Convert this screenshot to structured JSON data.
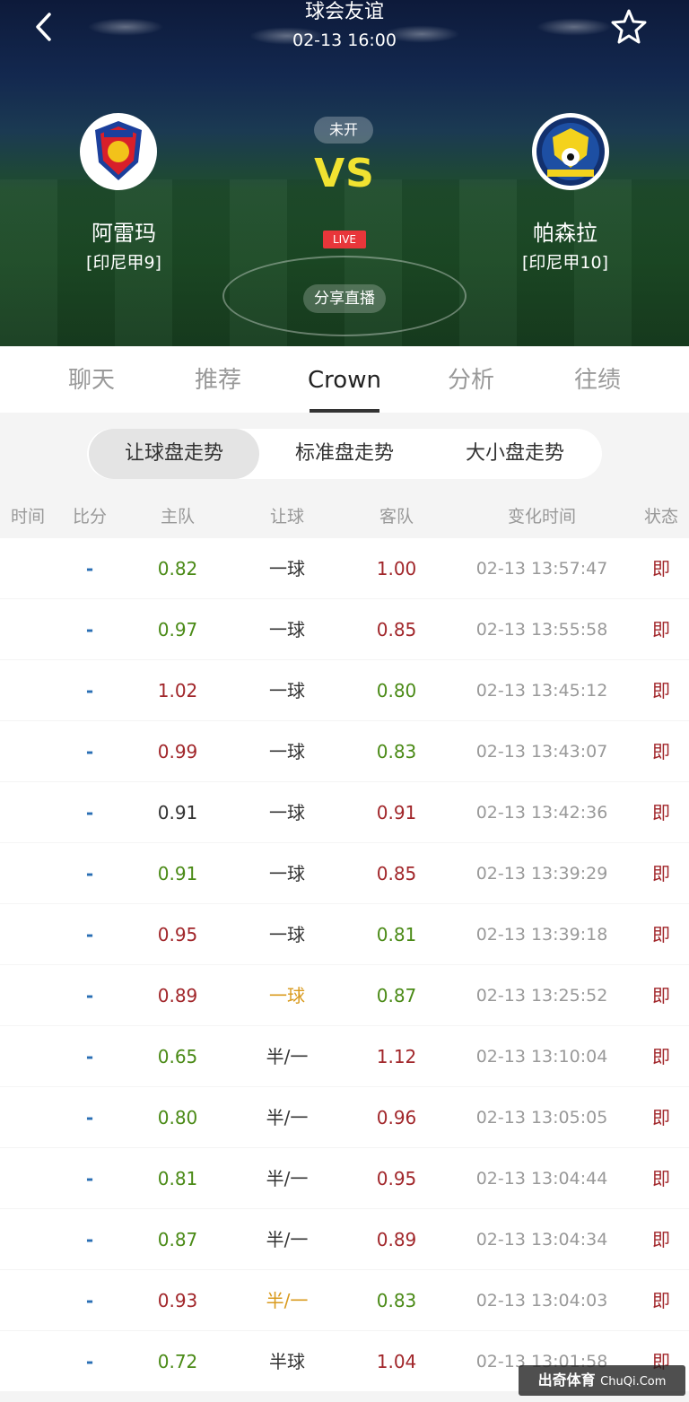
{
  "header": {
    "title": "球会友谊",
    "datetime": "02-13 16:00",
    "status": "未开",
    "vs": "VS",
    "live": "LIVE",
    "share": "分享直播",
    "home": {
      "name": "阿雷玛",
      "rank": "[印尼甲9]"
    },
    "away": {
      "name": "帕森拉",
      "rank": "[印尼甲10]"
    },
    "icons": {
      "back": "chevron-left-icon",
      "favorite": "star-outline-icon"
    }
  },
  "tabs": [
    {
      "label": "聊天",
      "active": false
    },
    {
      "label": "推荐",
      "active": false
    },
    {
      "label": "Crown",
      "active": true
    },
    {
      "label": "分析",
      "active": false
    },
    {
      "label": "往绩",
      "active": false
    }
  ],
  "segments": [
    {
      "label": "让球盘走势",
      "active": true
    },
    {
      "label": "标准盘走势",
      "active": false
    },
    {
      "label": "大小盘走势",
      "active": false
    }
  ],
  "table": {
    "columns": [
      "时间",
      "比分",
      "主队",
      "让球",
      "客队",
      "变化时间",
      "状态"
    ],
    "colors": {
      "up": "#a1262a",
      "down": "#4a8a16",
      "flat": "#333333",
      "changed": "#d99a1d"
    },
    "rows": [
      {
        "time": "",
        "score": "-",
        "home": "0.82",
        "home_c": "green",
        "hcap": "一球",
        "hcap_c": "black",
        "away": "1.00",
        "away_c": "red",
        "changed": "02-13 13:57:47",
        "state": "即"
      },
      {
        "time": "",
        "score": "-",
        "home": "0.97",
        "home_c": "green",
        "hcap": "一球",
        "hcap_c": "black",
        "away": "0.85",
        "away_c": "red",
        "changed": "02-13 13:55:58",
        "state": "即"
      },
      {
        "time": "",
        "score": "-",
        "home": "1.02",
        "home_c": "red",
        "hcap": "一球",
        "hcap_c": "black",
        "away": "0.80",
        "away_c": "green",
        "changed": "02-13 13:45:12",
        "state": "即"
      },
      {
        "time": "",
        "score": "-",
        "home": "0.99",
        "home_c": "red",
        "hcap": "一球",
        "hcap_c": "black",
        "away": "0.83",
        "away_c": "green",
        "changed": "02-13 13:43:07",
        "state": "即"
      },
      {
        "time": "",
        "score": "-",
        "home": "0.91",
        "home_c": "black",
        "hcap": "一球",
        "hcap_c": "black",
        "away": "0.91",
        "away_c": "red",
        "changed": "02-13 13:42:36",
        "state": "即"
      },
      {
        "time": "",
        "score": "-",
        "home": "0.91",
        "home_c": "green",
        "hcap": "一球",
        "hcap_c": "black",
        "away": "0.85",
        "away_c": "red",
        "changed": "02-13 13:39:29",
        "state": "即"
      },
      {
        "time": "",
        "score": "-",
        "home": "0.95",
        "home_c": "red",
        "hcap": "一球",
        "hcap_c": "black",
        "away": "0.81",
        "away_c": "green",
        "changed": "02-13 13:39:18",
        "state": "即"
      },
      {
        "time": "",
        "score": "-",
        "home": "0.89",
        "home_c": "red",
        "hcap": "一球",
        "hcap_c": "orange",
        "away": "0.87",
        "away_c": "green",
        "changed": "02-13 13:25:52",
        "state": "即"
      },
      {
        "time": "",
        "score": "-",
        "home": "0.65",
        "home_c": "green",
        "hcap": "半/一",
        "hcap_c": "black",
        "away": "1.12",
        "away_c": "red",
        "changed": "02-13 13:10:04",
        "state": "即"
      },
      {
        "time": "",
        "score": "-",
        "home": "0.80",
        "home_c": "green",
        "hcap": "半/一",
        "hcap_c": "black",
        "away": "0.96",
        "away_c": "red",
        "changed": "02-13 13:05:05",
        "state": "即"
      },
      {
        "time": "",
        "score": "-",
        "home": "0.81",
        "home_c": "green",
        "hcap": "半/一",
        "hcap_c": "black",
        "away": "0.95",
        "away_c": "red",
        "changed": "02-13 13:04:44",
        "state": "即"
      },
      {
        "time": "",
        "score": "-",
        "home": "0.87",
        "home_c": "green",
        "hcap": "半/一",
        "hcap_c": "black",
        "away": "0.89",
        "away_c": "red",
        "changed": "02-13 13:04:34",
        "state": "即"
      },
      {
        "time": "",
        "score": "-",
        "home": "0.93",
        "home_c": "red",
        "hcap": "半/一",
        "hcap_c": "orange",
        "away": "0.83",
        "away_c": "green",
        "changed": "02-13 13:04:03",
        "state": "即"
      },
      {
        "time": "",
        "score": "-",
        "home": "0.72",
        "home_c": "green",
        "hcap": "半球",
        "hcap_c": "black",
        "away": "1.04",
        "away_c": "red",
        "changed": "02-13 13:01:58",
        "state": "即"
      }
    ]
  },
  "watermark": {
    "text": "出奇体育",
    "site": "ChuQi.Com"
  }
}
